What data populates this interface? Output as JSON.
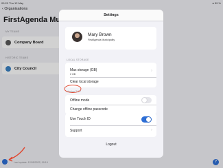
{
  "statusbar": {
    "time": "09:20 Thu 12 May",
    "right": "● 59 %"
  },
  "background": {
    "back_label": "Organisations",
    "title": "FirstAgenda Muni",
    "sections": [
      {
        "label": "MY TEAMS",
        "team": "Company Board"
      },
      {
        "label": "HISTORIC TEAMS",
        "team": "City Council"
      }
    ],
    "last_update": "Last update: 12/05/2022, 09:19",
    "help": "?"
  },
  "modal": {
    "title": "Settings",
    "user": {
      "name": "Mary Brown",
      "org": "FirstAgenda Municipality"
    },
    "local_storage_label": "LOCAL STORAGE",
    "max_storage_label": "Max storage (GB)",
    "max_storage_value": "2 GB",
    "clear_storage": "Clear local storage",
    "version": "Version 7.0.7",
    "offline_mode": "Offline mode",
    "offline_mode_on": false,
    "change_passcode": "Change offline passcode",
    "touch_id": "Use Touch ID",
    "touch_id_on": true,
    "support": "Support",
    "logout": "Logout"
  },
  "colors": {
    "accent": "#2e6fd6",
    "annotation": "#e0442c",
    "toggle_off": "#e5e5ea"
  }
}
